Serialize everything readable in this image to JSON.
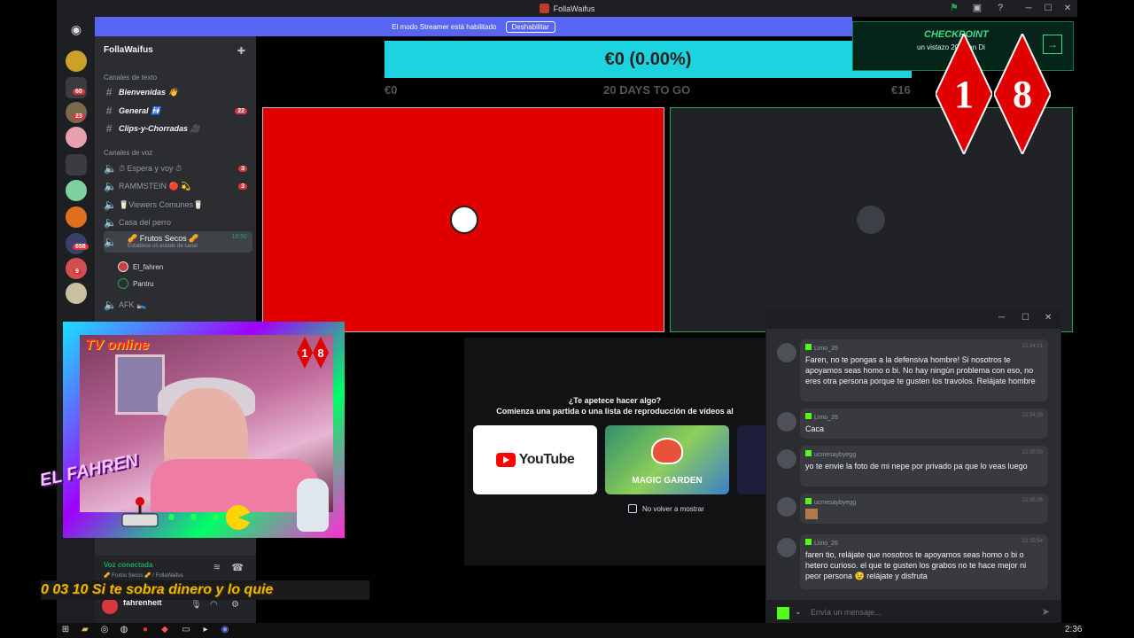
{
  "window": {
    "title": "FollaWaifus"
  },
  "banner": {
    "text": "El modo Streamer está habilitado",
    "button": "Deshabilitar"
  },
  "server": {
    "name": "FollaWaifus"
  },
  "rail_badges": [
    "60",
    "23",
    "658",
    "9"
  ],
  "sidebar": {
    "text_category": "Canales de texto",
    "text_channels": [
      {
        "label": "Bienvenidas 👋",
        "count": ""
      },
      {
        "label": "General 🚻",
        "count": "22"
      },
      {
        "label": "Clips-y-Chorradas 🎥",
        "count": ""
      }
    ],
    "voice_category": "Canales de voz",
    "voice_channels": [
      {
        "label": "⏱ Espera y voy ⏱",
        "count": "3"
      },
      {
        "label": "RAMMSTEIN 🔴 💫",
        "count": "3"
      },
      {
        "label": "🥛Viewers Comunes🥛",
        "count": ""
      },
      {
        "label": "Casa del perro",
        "count": ""
      }
    ],
    "active_channel": {
      "label": "🥜 Frutos Secos 🥜",
      "time": "18:50",
      "subtitle": "Establece un estado de canal"
    },
    "members": [
      "El_fahren",
      "Pantru"
    ],
    "afk_channel": "AFK 🛌"
  },
  "voice_panel": {
    "status": "Voz conectada",
    "location": "🥜 Frutos Secos 🥜 / FollaWaifus"
  },
  "user_panel": {
    "username": "fahrenheit"
  },
  "stage": {
    "progress_text": "€0 (0.00%)",
    "progress_fraction": 0.0,
    "left_value": "€0",
    "center_label": "20 DAYS TO GO",
    "right_value": "€16"
  },
  "activity": {
    "question": "¿Te apetece hacer algo?",
    "prompt": "Comienza una partida o una lista de reproducción de vídeos al",
    "cards": [
      "YouTube",
      "MAGIC GARDEN"
    ],
    "checkbox_label": "No volver a mostrar"
  },
  "checkpoint": {
    "title": "CHECKPOINT",
    "text": "un vistazo 2025 en Di"
  },
  "overlay": {
    "big_digits": [
      "1",
      "8"
    ],
    "small_digits": [
      "1",
      "8"
    ],
    "tv_label": "TV online",
    "name_logo": "EL FAHREN",
    "ticker": "0 03 10 Si te sobra dinero y lo quie"
  },
  "chat": {
    "messages": [
      {
        "user": "Limo_26",
        "time": "22:34:21",
        "text": "Faren, no te pongas a la defensiva hombre! Si nosotros te apoyamos seas homo o bi. No hay ningún problema con eso, no eres otra persona porque te gusten los travolos. Relájate hombre"
      },
      {
        "user": "Limo_26",
        "time": "22:34:28",
        "text": "Caca"
      },
      {
        "user": "ucmesaybyegg",
        "time": "22:35:00",
        "text": "yo te envie la foto de mi nepe por privado pa que lo veas luego"
      },
      {
        "user": "ucmesaybyegg",
        "time": "22:35:25",
        "text": ""
      },
      {
        "user": "Limo_26",
        "time": "22:35:54",
        "text": "faren tio, relájate que nosotros te apoyamos seas homo o bi o hetero curioso. el que te gusten los grabos no te hace mejor ni peor persona 😉 relájate y disfruta"
      }
    ],
    "input_placeholder": "Envía un mensaje..."
  },
  "taskbar": {
    "clock": "2:36"
  },
  "colors": {
    "discord_blurple": "#5865f2",
    "progress_cyan": "#1ed3e0",
    "tile_red": "#e00000",
    "kick_green": "#53fc18",
    "voice_green": "#23a55a"
  }
}
